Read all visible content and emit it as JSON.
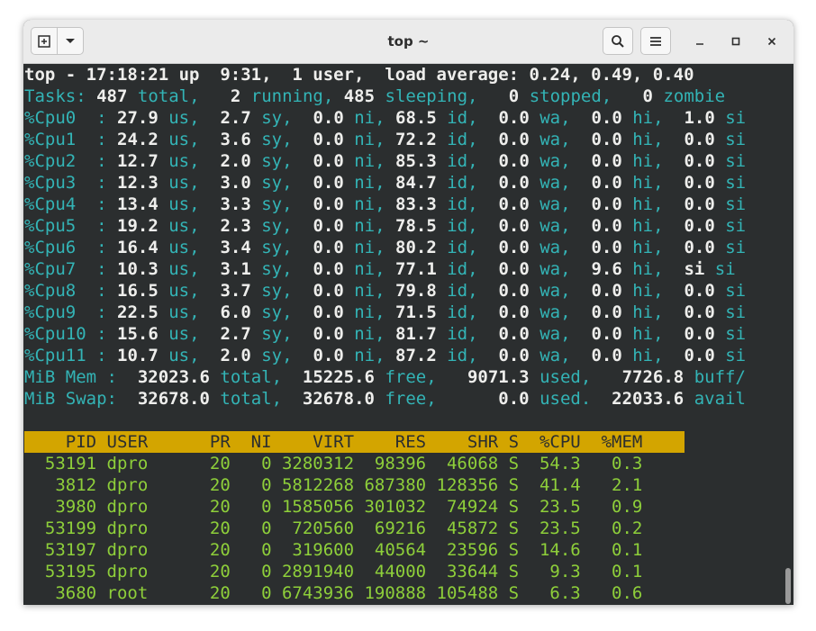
{
  "window": {
    "title": "top ~",
    "new_tab_icon": "new-tab-icon",
    "dropdown_icon": "chevron-down-icon",
    "search_icon": "search-icon",
    "menu_icon": "hamburger-menu-icon",
    "minimize_icon": "minimize-icon",
    "maximize_icon": "maximize-icon",
    "close_icon": "close-icon"
  },
  "summary": {
    "line1": "top - 17:18:21 up  9:31,  1 user,  load average: 0.24, 0.49, 0.40",
    "tasks": {
      "label": "Tasks:",
      "total": "487",
      "total_lbl": "total,",
      "running": "2",
      "running_lbl": "running,",
      "sleeping": "485",
      "sleeping_lbl": "sleeping,",
      "stopped": "0",
      "stopped_lbl": "stopped,",
      "zombie": "0",
      "zombie_lbl": "zombie"
    }
  },
  "cpus": [
    {
      "name": "%Cpu0 ",
      "us": "27.9",
      "sy": "2.7",
      "ni": "0.0",
      "id": "68.5",
      "wa": "0.0",
      "hi": "0.0",
      "si": "1.0"
    },
    {
      "name": "%Cpu1 ",
      "us": "24.2",
      "sy": "3.6",
      "ni": "0.0",
      "id": "72.2",
      "wa": "0.0",
      "hi": "0.0",
      "si": "0.0"
    },
    {
      "name": "%Cpu2 ",
      "us": "12.7",
      "sy": "2.0",
      "ni": "0.0",
      "id": "85.3",
      "wa": "0.0",
      "hi": "0.0",
      "si": "0.0"
    },
    {
      "name": "%Cpu3 ",
      "us": "12.3",
      "sy": "3.0",
      "ni": "0.0",
      "id": "84.7",
      "wa": "0.0",
      "hi": "0.0",
      "si": "0.0"
    },
    {
      "name": "%Cpu4 ",
      "us": "13.4",
      "sy": "3.3",
      "ni": "0.0",
      "id": "83.3",
      "wa": "0.0",
      "hi": "0.0",
      "si": "0.0"
    },
    {
      "name": "%Cpu5 ",
      "us": "19.2",
      "sy": "2.3",
      "ni": "0.0",
      "id": "78.5",
      "wa": "0.0",
      "hi": "0.0",
      "si": "0.0"
    },
    {
      "name": "%Cpu6 ",
      "us": "16.4",
      "sy": "3.4",
      "ni": "0.0",
      "id": "80.2",
      "wa": "0.0",
      "hi": "0.0",
      "si": "0.0"
    },
    {
      "name": "%Cpu7 ",
      "us": "10.3",
      "sy": "3.1",
      "ni": "0.0",
      "id": "77.1",
      "wa": "0.0",
      "hi": "9.6",
      "si": "si"
    },
    {
      "name": "%Cpu8 ",
      "us": "16.5",
      "sy": "3.7",
      "ni": "0.0",
      "id": "79.8",
      "wa": "0.0",
      "hi": "0.0",
      "si": "0.0"
    },
    {
      "name": "%Cpu9 ",
      "us": "22.5",
      "sy": "6.0",
      "ni": "0.0",
      "id": "71.5",
      "wa": "0.0",
      "hi": "0.0",
      "si": "0.0"
    },
    {
      "name": "%Cpu10",
      "us": "15.6",
      "sy": "2.7",
      "ni": "0.0",
      "id": "81.7",
      "wa": "0.0",
      "hi": "0.0",
      "si": "0.0"
    },
    {
      "name": "%Cpu11",
      "us": "10.7",
      "sy": "2.0",
      "ni": "0.0",
      "id": "87.2",
      "wa": "0.0",
      "hi": "0.0",
      "si": "0.0"
    }
  ],
  "mem": {
    "label": "MiB Mem :",
    "total": "32023.6",
    "total_lbl": "total,",
    "free": "15225.6",
    "free_lbl": "free,",
    "used": "9071.3",
    "used_lbl": "used,",
    "buff": "7726.8",
    "buff_lbl": "buff/"
  },
  "swap": {
    "label": "MiB Swap:",
    "total": "32678.0",
    "total_lbl": "total,",
    "free": "32678.0",
    "free_lbl": "free,",
    "used": "0.0",
    "used_lbl": "used.",
    "avail": "22033.6",
    "avail_lbl": "avail"
  },
  "proc_header": "    PID USER      PR  NI    VIRT    RES    SHR S  %CPU  %MEM",
  "processes": [
    "  53191 dpro      20   0 3280312  98396  46068 S  54.3   0.3",
    "   3812 dpro      20   0 5812268 687380 128356 S  41.4   2.1",
    "   3980 dpro      20   0 1585056 301032  74924 S  23.5   0.9",
    "  53199 dpro      20   0  720560  69216  45872 S  23.5   0.2",
    "  53197 dpro      20   0  319600  40564  23596 S  14.6   0.1",
    "  53195 dpro      20   0 2891940  44000  33644 S   9.3   0.1",
    "   3680 root      20   0 6743936 190888 105488 S   6.3   0.6"
  ]
}
